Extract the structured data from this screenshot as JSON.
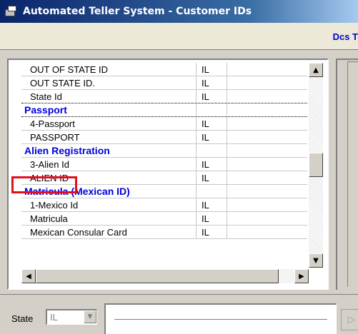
{
  "window": {
    "title": "Automated Teller System - Customer IDs"
  },
  "header": {
    "right_text": "Dcs T"
  },
  "list": {
    "rows": [
      {
        "type": "item",
        "name": "OUT OF STATE ID",
        "state": "IL"
      },
      {
        "type": "item",
        "name": "OUT STATE ID.",
        "state": "IL"
      },
      {
        "type": "item",
        "name": "State Id",
        "state": "IL"
      },
      {
        "type": "header",
        "name": "Passport",
        "state": ""
      },
      {
        "type": "item",
        "name": "4-Passport",
        "state": "IL"
      },
      {
        "type": "item",
        "name": "PASSPORT",
        "state": "IL"
      },
      {
        "type": "header",
        "name": "Alien Registration",
        "state": ""
      },
      {
        "type": "item",
        "name": "3-Alien Id",
        "state": "IL"
      },
      {
        "type": "item",
        "name": "ALIEN ID",
        "state": "IL"
      },
      {
        "type": "header",
        "name": "Matricula (Mexican ID)",
        "state": ""
      },
      {
        "type": "item",
        "name": "1-Mexico Id",
        "state": "IL"
      },
      {
        "type": "item",
        "name": "Matricula",
        "state": "IL"
      },
      {
        "type": "item",
        "name": "Mexican Consular Card",
        "state": "IL"
      }
    ],
    "highlighted_header": "Passport"
  },
  "scroll": {
    "up": "▲",
    "down": "▼",
    "left": "◀",
    "right": "▶"
  },
  "footer": {
    "state_label": "State",
    "state_value": "IL",
    "dropdown_arrow": "▼",
    "nav_arrow": "▷"
  },
  "colors": {
    "title_bg": "#0a246a",
    "header_text": "#0000dd",
    "highlight": "#e01020"
  }
}
